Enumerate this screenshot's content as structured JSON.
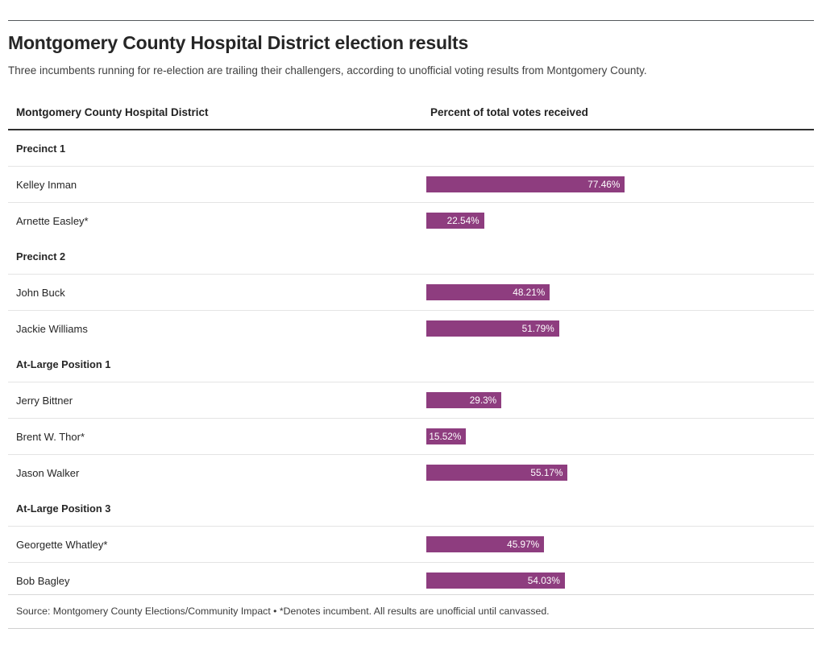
{
  "headline": "Montgomery County Hospital District election results",
  "subhead": "Three incumbents running for re-election are trailing their challengers, according to unofficial voting results from Montgomery County.",
  "table": {
    "columns": {
      "name": "Montgomery County Hospital District",
      "bar": "Percent of total votes received"
    }
  },
  "source_note": "Source: Montgomery County Elections/Community Impact • *Denotes incumbent. All results are unofficial until canvassed.",
  "colors": {
    "bar": "#8e3d7f",
    "bar_label": "#ffffff",
    "header_rule": "#2f2f2f",
    "row_rule": "#e4e4e4",
    "text": "#262626"
  },
  "chart_data": {
    "type": "bar",
    "title": "Montgomery County Hospital District election results",
    "subtitle": "Three incumbents running for re-election are trailing their challengers, according to unofficial voting results from Montgomery County.",
    "xlabel": "Percent of total votes received",
    "ylabel": "Montgomery County Hospital District",
    "xlim": [
      0,
      100
    ],
    "grid": false,
    "legend": "none",
    "orientation": "horizontal",
    "value_suffix": "%",
    "groups": [
      {
        "label": "Precinct 1",
        "rows": [
          {
            "name": "Kelley Inman",
            "value": 77.46,
            "label": "77.46%",
            "incumbent": false
          },
          {
            "name": "Arnette Easley*",
            "value": 22.54,
            "label": "22.54%",
            "incumbent": true
          }
        ]
      },
      {
        "label": "Precinct 2",
        "rows": [
          {
            "name": "John Buck",
            "value": 48.21,
            "label": "48.21%",
            "incumbent": false
          },
          {
            "name": "Jackie Williams",
            "value": 51.79,
            "label": "51.79%",
            "incumbent": false
          }
        ]
      },
      {
        "label": "At-Large Position 1",
        "rows": [
          {
            "name": "Jerry Bittner",
            "value": 29.3,
            "label": "29.3%",
            "incumbent": false
          },
          {
            "name": "Brent W. Thor*",
            "value": 15.52,
            "label": "15.52%",
            "incumbent": true
          },
          {
            "name": "Jason Walker",
            "value": 55.17,
            "label": "55.17%",
            "incumbent": false
          }
        ]
      },
      {
        "label": "At-Large Position 3",
        "rows": [
          {
            "name": "Georgette Whatley*",
            "value": 45.97,
            "label": "45.97%",
            "incumbent": true
          },
          {
            "name": "Bob Bagley",
            "value": 54.03,
            "label": "54.03%",
            "incumbent": false
          }
        ]
      }
    ]
  }
}
